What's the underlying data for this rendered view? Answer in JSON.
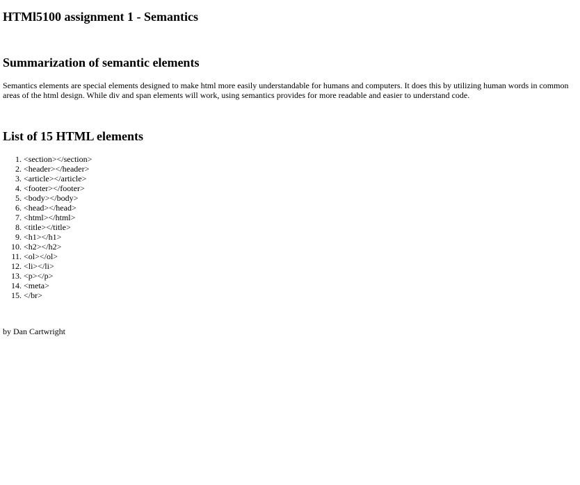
{
  "header": {
    "title": "HTMl5100 assignment 1 - Semantics"
  },
  "summary": {
    "title": "Summarization of semantic elements",
    "text": "Semantics elements are special elements designed to make html more easily understandable for humans and computers. It does this by utilizing human words in common areas of the html design. While div and span elements will work, using semantics provides for more readable and easier to understand code."
  },
  "elements_list": {
    "title": "List of 15 HTML elements",
    "items": [
      "<section></section>",
      "<header></header>",
      "<article></article>",
      "<footer></footer>",
      "<body></body>",
      "<head></head>",
      "<html></html>",
      "<title></title>",
      "<h1></h1>",
      "<h2></h2>",
      "<ol></ol>",
      "<li></li>",
      "<p></p>",
      "<meta>",
      "</br>"
    ]
  },
  "footer": {
    "byline": "by Dan Cartwright"
  }
}
